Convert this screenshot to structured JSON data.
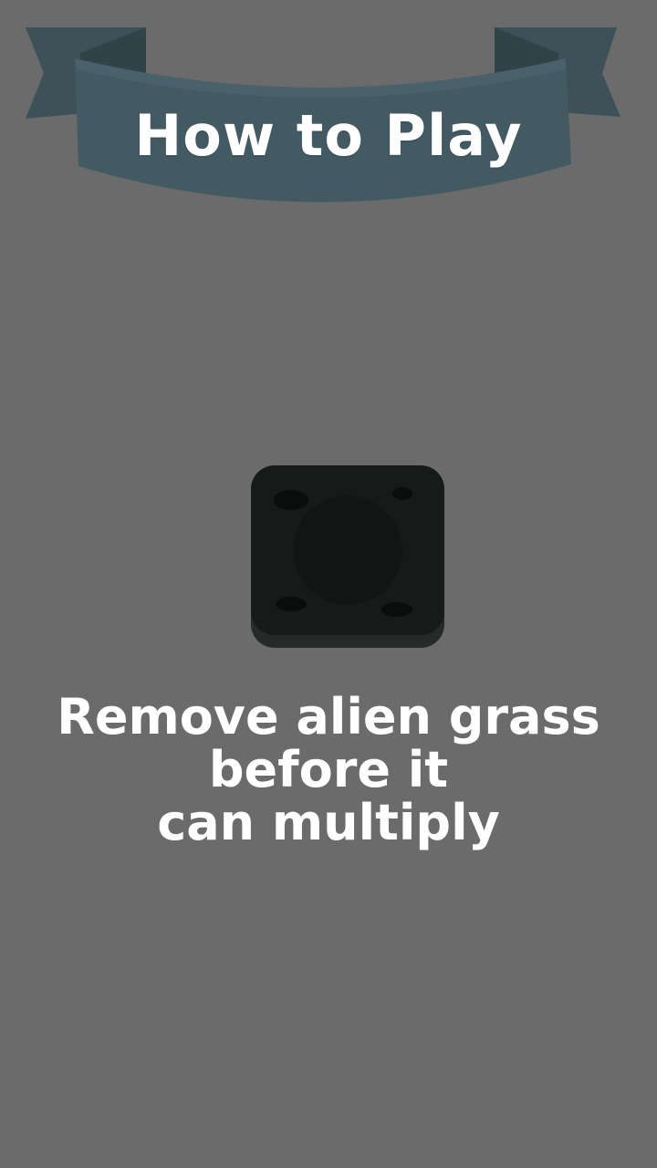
{
  "screen": {
    "background_color": "#6b6b6b"
  },
  "banner": {
    "title": "How to Play",
    "ribbon_color": "#435a63",
    "tail_color": "#3c5258",
    "tail_shadow_color": "#2f4349"
  },
  "tile": {
    "icon": "dark-grass-tile-icon",
    "color": "#161a19"
  },
  "instruction": {
    "line1": "Remove alien grass",
    "line2": "before it",
    "line3": "can multiply"
  }
}
